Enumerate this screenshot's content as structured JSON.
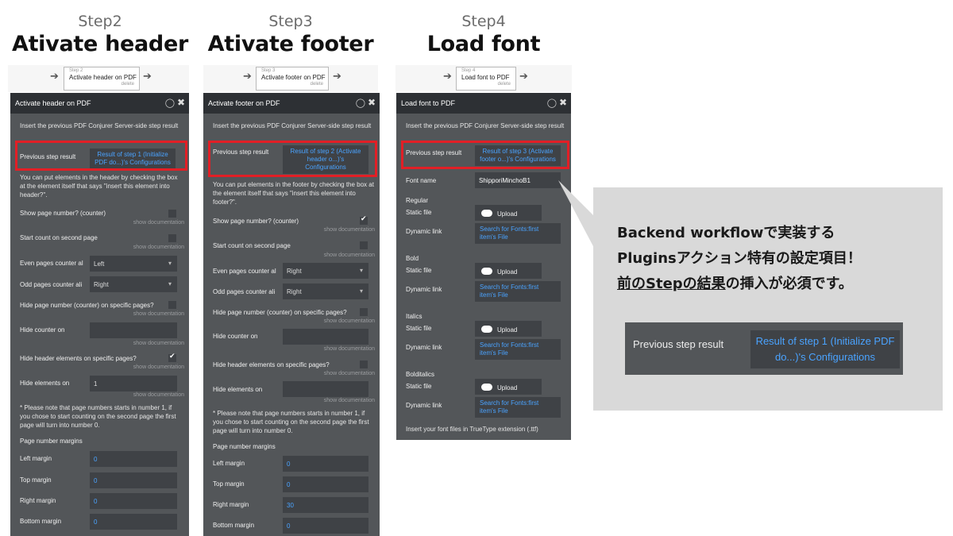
{
  "columns": [
    {
      "step_no": "Step2",
      "title": "Ativate header",
      "flow": {
        "small": "Step 2",
        "main": "Activate header on PDF",
        "del": "delete"
      },
      "panel_title": "Activate header on PDF",
      "intro": "Insert the previous PDF Conjurer Server-side step result",
      "prev_label": "Previous step result",
      "prev_value": "Result of step 1 (Initialize PDF do...)'s Configurations",
      "desc": "You can put elements in the header by checking the box at the element itself that says \"insert this element into header?\".",
      "show_page_number": "Show page number? (counter)",
      "show_doc": "show documentation",
      "start_count": "Start count on second page",
      "even_label": "Even pages counter al",
      "even_value": "Left",
      "odd_label": "Odd pages counter ali",
      "odd_value": "Right",
      "hide_page_number": "Hide page number (counter) on specific pages?",
      "hide_counter_on": "Hide counter on",
      "hide_elements_q": "Hide header elements on specific pages?",
      "hide_elements_on": "Hide elements on",
      "hide_elements_value": "1",
      "note": "* Please note that page numbers starts in number 1, if you chose to start counting on the second page the first page will turn into number 0.",
      "margins_title": "Page number margins",
      "left_margin": "Left margin",
      "left_value": "0",
      "top_margin": "Top margin",
      "top_value": "0",
      "right_margin": "Right margin",
      "right_value": "0",
      "bottom_margin": "Bottom margin",
      "bottom_value": "0"
    },
    {
      "step_no": "Step3",
      "title": "Ativate footer",
      "flow": {
        "small": "Step 3",
        "main": "Activate footer on PDF",
        "del": "delete"
      },
      "panel_title": "Activate footer on PDF",
      "intro": "Insert the previous PDF Conjurer Server-side step result",
      "prev_label": "Previous step result",
      "prev_value": "Result of step 2 (Activate header o...)'s Configurations",
      "desc": "You can put elements in the footer by checking the box at the element itself that says \"insert this element into footer?\".",
      "show_page_number": "Show page number? (counter)",
      "show_doc": "show documentation",
      "start_count": "Start count on second page",
      "even_label": "Even pages counter al",
      "even_value": "Right",
      "odd_label": "Odd pages counter ali",
      "odd_value": "Right",
      "hide_page_number": "Hide page number (counter) on specific pages?",
      "hide_counter_on": "Hide counter on",
      "hide_elements_q": "Hide header elements on specific pages?",
      "hide_elements_on": "Hide elements on",
      "note": "* Please note that page numbers starts in number 1, if you chose to start counting on the second page the first page will turn into number 0.",
      "margins_title": "Page number margins",
      "left_margin": "Left margin",
      "left_value": "0",
      "top_margin": "Top margin",
      "top_value": "0",
      "right_margin": "Right margin",
      "right_value": "30",
      "bottom_margin": "Bottom margin",
      "bottom_value": "0"
    },
    {
      "step_no": "Step4",
      "title": "Load font",
      "flow": {
        "small": "Step 4",
        "main": "Load font to PDF",
        "del": "delete"
      },
      "panel_title": "Load font to PDF",
      "intro": "Insert the previous PDF Conjurer Server-side step result",
      "prev_label": "Previous step result",
      "prev_value": "Result of step 3 (Activate footer o...)'s Configurations",
      "font_name_label": "Font name",
      "font_name_value": "ShipporiMinchoB1",
      "regular": "Regular",
      "bold": "Bold",
      "italics": "Italics",
      "bolditalics": "Bolditalics",
      "static_file": "Static file",
      "dynamic_link": "Dynamic link",
      "upload": "Upload",
      "search_value": "Search for Fonts:first item's File",
      "footer_note": "Insert your font files in TrueType extension (.ttf)"
    }
  ],
  "callout": {
    "line1": "Backend workflowで実装する",
    "line2": "Pluginsアクション特有の設定項目！",
    "line3_underlined": "前のStepの結果",
    "line3_rest": "の挿入が必須です。",
    "example_label": "Previous step result",
    "example_value": "Result of step 1 (Initialize PDF do...)'s Configurations"
  },
  "colors": {
    "panel": "#535659",
    "header": "#2d3034",
    "field": "#3f4246",
    "link": "#4aa3ff",
    "highlight": "#e21f26",
    "callout": "#d9d9d9"
  }
}
